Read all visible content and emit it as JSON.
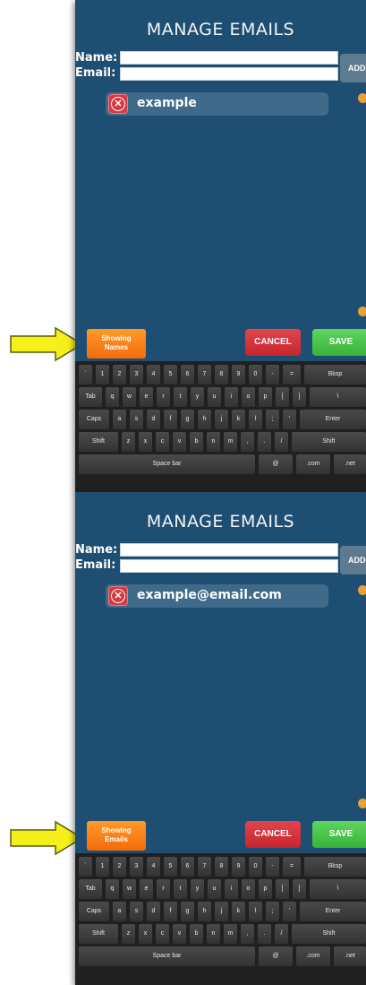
{
  "colors": {
    "panel_bg": "#1e4f72",
    "showing_orange": "#f7801a",
    "cancel_red": "#d2323b",
    "save_green": "#4cc44c",
    "arrow_yellow": "#f5ef1a"
  },
  "panels": [
    {
      "title": "MANAGE EMAILS",
      "name_label": "Name:",
      "email_label": "Email:",
      "add_label": "ADD",
      "entry_text": "example",
      "showing_line1": "Showing",
      "showing_line2": "Names",
      "cancel_label": "CANCEL",
      "save_label": "SAVE"
    },
    {
      "title": "MANAGE EMAILS",
      "name_label": "Name:",
      "email_label": "Email:",
      "add_label": "ADD",
      "entry_text": "example@email.com",
      "showing_line1": "Showing",
      "showing_line2": "Emails",
      "cancel_label": "CANCEL",
      "save_label": "SAVE"
    }
  ],
  "keyboard": {
    "rows": [
      [
        "`",
        "1",
        "2",
        "3",
        "4",
        "5",
        "6",
        "7",
        "8",
        "9",
        "0",
        "-",
        "=",
        "Bksp"
      ],
      [
        "Tab",
        "q",
        "w",
        "e",
        "r",
        "t",
        "y",
        "u",
        "i",
        "o",
        "p",
        "[",
        "]",
        "\\"
      ],
      [
        "Caps",
        "a",
        "s",
        "d",
        "f",
        "g",
        "h",
        "j",
        "k",
        "l",
        ";",
        "'",
        "Enter"
      ],
      [
        "Shift",
        "z",
        "x",
        "c",
        "v",
        "b",
        "n",
        "m",
        ",",
        ".",
        "/",
        "Shift"
      ],
      [
        "Space bar",
        "@",
        ".com",
        ".net"
      ]
    ]
  },
  "icons": {
    "remove": "close-circle-icon",
    "arrow": "right-arrow-icon"
  }
}
